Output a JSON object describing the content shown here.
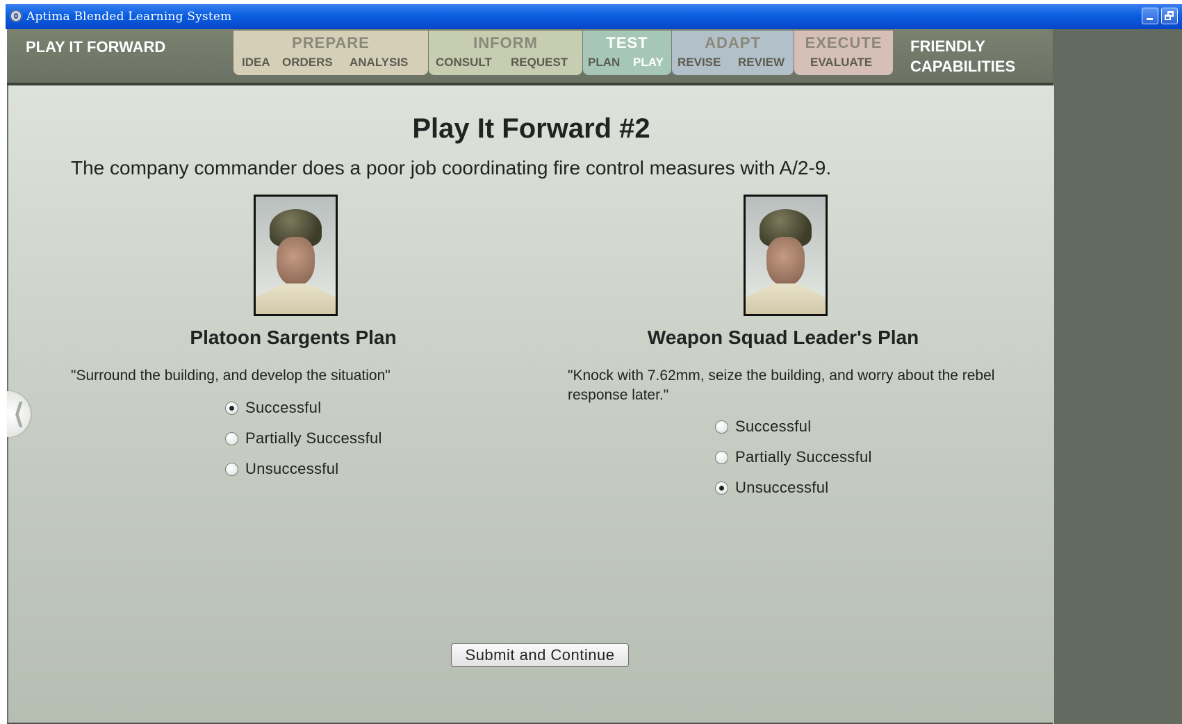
{
  "window": {
    "title": "Aptima Blended Learning System"
  },
  "nav": {
    "brand": "PLAY IT FORWARD",
    "groups": [
      {
        "title": "PREPARE",
        "items": [
          "IDEA",
          "ORDERS",
          "ANALYSIS"
        ]
      },
      {
        "title": "INFORM",
        "items": [
          "CONSULT",
          "REQUEST"
        ]
      },
      {
        "title": "TEST",
        "items": [
          "PLAN",
          "PLAY"
        ],
        "active_item": "PLAY"
      },
      {
        "title": "ADAPT",
        "items": [
          "REVISE",
          "REVIEW"
        ]
      },
      {
        "title": "EXECUTE",
        "items": [
          "EVALUATE"
        ]
      }
    ],
    "friendly_line1": "FRIENDLY",
    "friendly_line2": "CAPABILITIES"
  },
  "page": {
    "title": "Play It Forward #2",
    "scenario": "The company commander does a poor job coordinating fire control measures with A/2-9."
  },
  "plans": [
    {
      "title": "Platoon Sargents Plan",
      "quote": "\"Surround the building, and develop the situation\"",
      "options": [
        "Successful",
        "Partially Successful",
        "Unsuccessful"
      ],
      "selected": "Successful"
    },
    {
      "title": "Weapon Squad Leader's Plan",
      "quote": "\"Knock with 7.62mm, seize the building, and worry about the rebel response later.\"",
      "options": [
        "Successful",
        "Partially Successful",
        "Unsuccessful"
      ],
      "selected": "Unsuccessful"
    }
  ],
  "submit_label": "Submit and Continue",
  "colors": {
    "titlebar": "#0a5fe0",
    "nav_bg": "#737a6b",
    "prepare": "#d5cfb8",
    "inform": "#c6cdb0",
    "test": "#a6c7b7",
    "adapt": "#b2c0c9",
    "execute": "#d6bfb7",
    "right_pane": "#636a5f"
  }
}
